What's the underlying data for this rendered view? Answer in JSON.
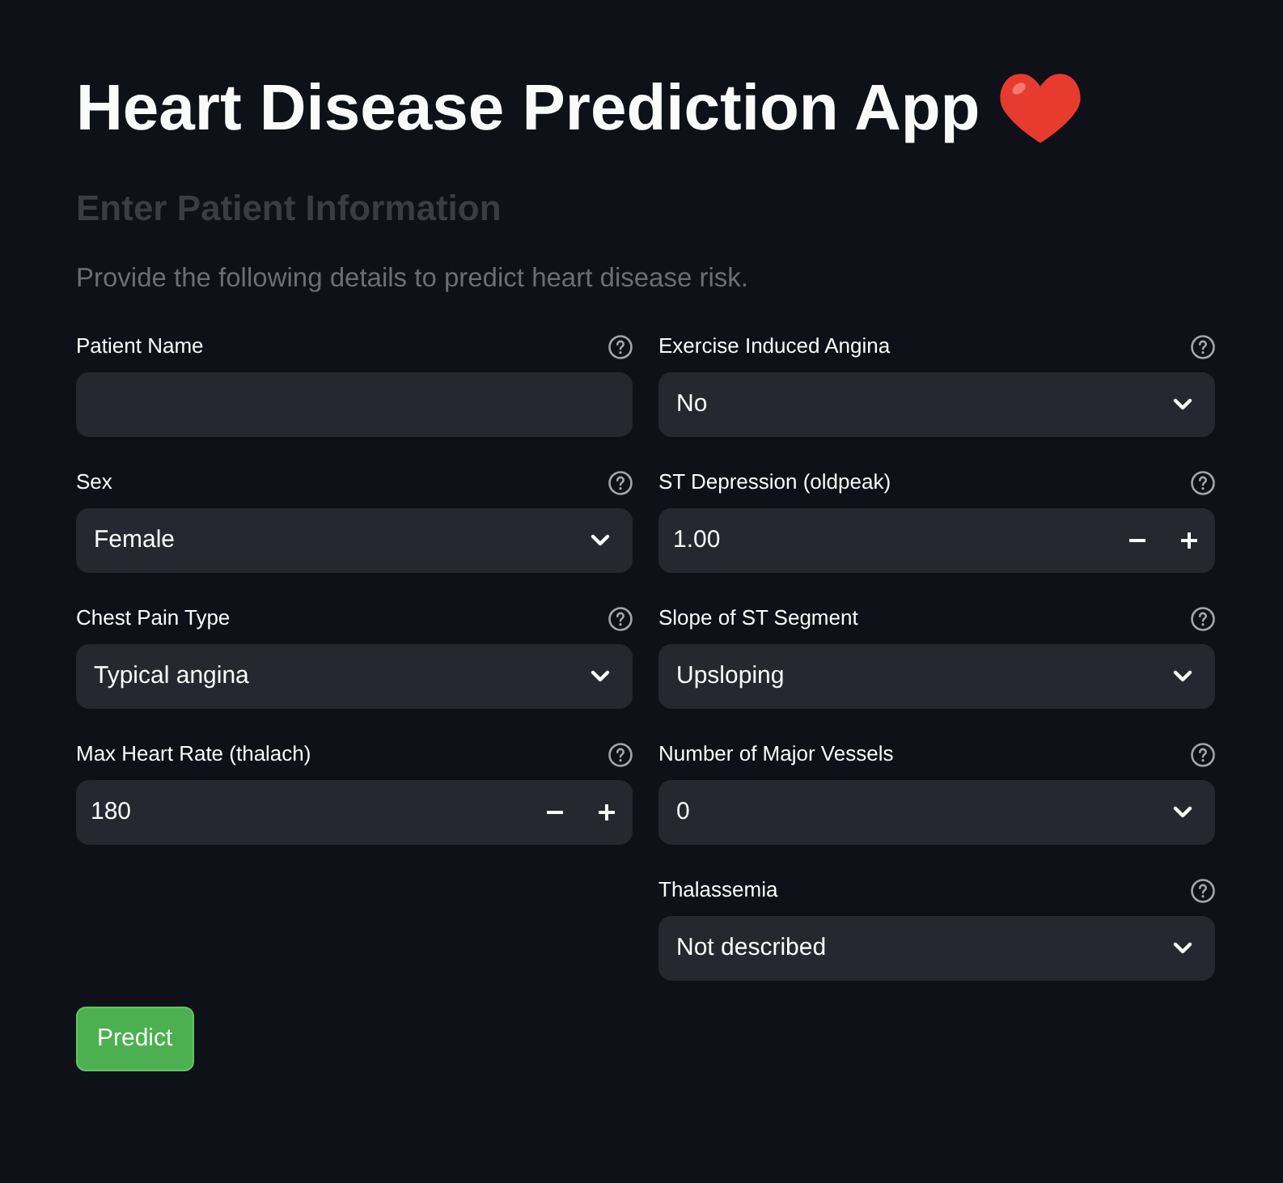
{
  "page": {
    "title": "Heart Disease Prediction App",
    "subheader": "Enter Patient Information",
    "caption": "Provide the following details to predict heart disease risk."
  },
  "form": {
    "columns": [
      {
        "fields": [
          {
            "kind": "text",
            "label": "Patient Name"
          },
          {
            "kind": "select",
            "label": "Sex",
            "value": "Female"
          },
          {
            "kind": "select",
            "label": "Chest Pain Type",
            "value": "Typical angina"
          },
          {
            "kind": "number",
            "label": "Max Heart Rate (thalach)",
            "value": "180"
          }
        ]
      },
      {
        "fields": [
          {
            "kind": "select",
            "label": "Exercise Induced Angina",
            "value": "No"
          },
          {
            "kind": "number",
            "label": "ST Depression (oldpeak)",
            "value": "1.00"
          },
          {
            "kind": "select",
            "label": "Slope of ST Segment",
            "value": "Upsloping"
          },
          {
            "kind": "select",
            "label": "Number of Major Vessels",
            "value": "0"
          },
          {
            "kind": "select",
            "label": "Thalassemia",
            "value": "Not described"
          }
        ]
      }
    ]
  },
  "buttons": [
    {
      "kind": "primary",
      "label": "Predict"
    }
  ]
}
